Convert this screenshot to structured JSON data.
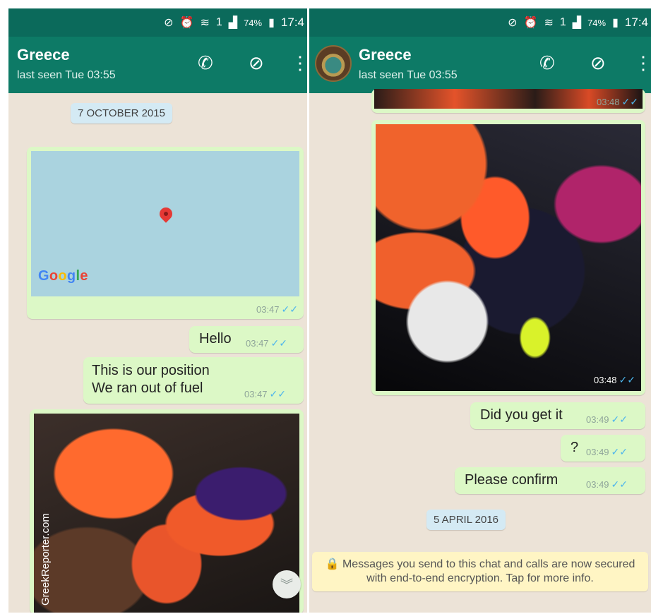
{
  "status": {
    "time": "17:4",
    "battery": "74%",
    "sim": "1"
  },
  "left": {
    "contact_name": "Greece",
    "last_seen": "last seen Tue 03:55",
    "date_chip": "7 OCTOBER 2015",
    "map": {
      "logo_text": "Google",
      "time": "03:47"
    },
    "messages": [
      {
        "text": "Hello",
        "time": "03:47"
      },
      {
        "line1": "This is our position",
        "line2": "We ran out of fuel",
        "time": "03:47"
      }
    ],
    "watermark": "GreekReporter.com"
  },
  "right": {
    "contact_name": "Greece",
    "last_seen": "last seen Tue 03:55",
    "photo_top_time": "03:48",
    "photo_time": "03:48",
    "messages": [
      {
        "text": "Did you get it",
        "time": "03:49"
      },
      {
        "text": "?",
        "time": "03:49"
      },
      {
        "text": "Please confirm",
        "time": "03:49"
      }
    ],
    "date_chip": "5 APRIL 2016",
    "security_notice": "🔒 Messages you send to this chat and calls are now secured with end-to-end encryption. Tap for more info."
  },
  "colors": {
    "header": "#0d7a66",
    "status_bar": "#0b6a5b",
    "bubble": "#dcf8c6",
    "read_tick": "#4fb6ec"
  },
  "icons": {
    "call": "phone-icon",
    "attach": "paperclip-icon",
    "menu": "more-vert-icon",
    "read": "double-check-icon",
    "scroll": "chevron-double-down-icon"
  }
}
